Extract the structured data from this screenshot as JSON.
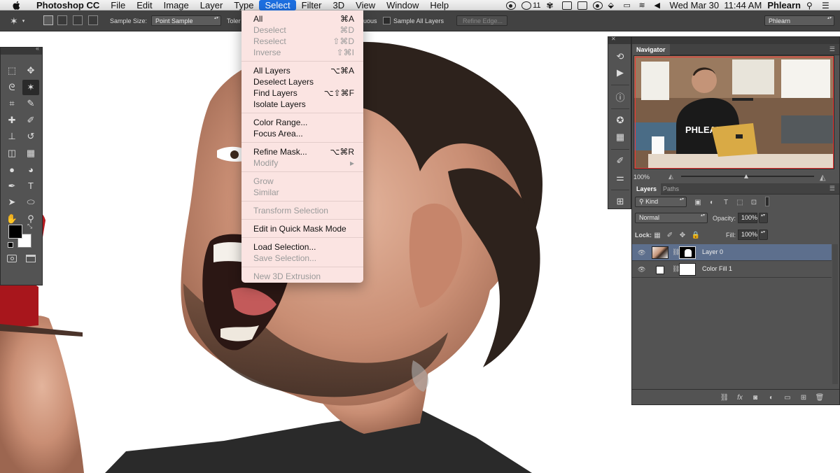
{
  "menubar": {
    "app_name": "Photoshop CC",
    "items": [
      "File",
      "Edit",
      "Image",
      "Layer",
      "Type",
      "Select",
      "Filter",
      "3D",
      "View",
      "Window",
      "Help"
    ],
    "active_index": 5,
    "tray_badge": "11",
    "datetime": "Wed Mar 30  11:44 AM",
    "user": "Phlearn"
  },
  "options_bar": {
    "sample_size_label": "Sample Size:",
    "sample_size_value": "Point Sample",
    "tolerance_label": "Toler",
    "contiguous_label": "uous",
    "sample_all_layers_label": "Sample All Layers",
    "refine_edge_label": "Refine Edge...",
    "workspace_value": "Phlearn"
  },
  "select_menu": {
    "groups": [
      [
        {
          "label": "All",
          "shortcut": "⌘A",
          "enabled": true
        },
        {
          "label": "Deselect",
          "shortcut": "⌘D",
          "enabled": false
        },
        {
          "label": "Reselect",
          "shortcut": "⇧⌘D",
          "enabled": false
        },
        {
          "label": "Inverse",
          "shortcut": "⇧⌘I",
          "enabled": false
        }
      ],
      [
        {
          "label": "All Layers",
          "shortcut": "⌥⌘A",
          "enabled": true
        },
        {
          "label": "Deselect Layers",
          "shortcut": "",
          "enabled": true
        },
        {
          "label": "Find Layers",
          "shortcut": "⌥⇧⌘F",
          "enabled": true
        },
        {
          "label": "Isolate Layers",
          "shortcut": "",
          "enabled": true
        }
      ],
      [
        {
          "label": "Color Range...",
          "shortcut": "",
          "enabled": true
        },
        {
          "label": "Focus Area...",
          "shortcut": "",
          "enabled": true
        }
      ],
      [
        {
          "label": "Refine Mask...",
          "shortcut": "⌥⌘R",
          "enabled": true
        },
        {
          "label": "Modify",
          "shortcut": "▸",
          "enabled": false
        }
      ],
      [
        {
          "label": "Grow",
          "shortcut": "",
          "enabled": false
        },
        {
          "label": "Similar",
          "shortcut": "",
          "enabled": false
        }
      ],
      [
        {
          "label": "Transform Selection",
          "shortcut": "",
          "enabled": false
        }
      ],
      [
        {
          "label": "Edit in Quick Mask Mode",
          "shortcut": "",
          "enabled": true
        }
      ],
      [
        {
          "label": "Load Selection...",
          "shortcut": "",
          "enabled": true
        },
        {
          "label": "Save Selection...",
          "shortcut": "",
          "enabled": false
        }
      ],
      [
        {
          "label": "New 3D Extrusion",
          "shortcut": "",
          "enabled": false
        }
      ]
    ]
  },
  "toolbox": {
    "tools": [
      {
        "icon": "marquee-tool-icon",
        "glyph": "⬚"
      },
      {
        "icon": "move-tool-icon",
        "glyph": "✥"
      },
      {
        "icon": "lasso-tool-icon",
        "glyph": "ᘓ"
      },
      {
        "icon": "magic-wand-tool-icon",
        "glyph": "✶"
      },
      {
        "icon": "crop-tool-icon",
        "glyph": "⌗"
      },
      {
        "icon": "eyedropper-tool-icon",
        "glyph": "✎"
      },
      {
        "icon": "healing-brush-tool-icon",
        "glyph": "✚"
      },
      {
        "icon": "brush-tool-icon",
        "glyph": "✐"
      },
      {
        "icon": "clone-stamp-tool-icon",
        "glyph": "⊥"
      },
      {
        "icon": "history-brush-tool-icon",
        "glyph": "↺"
      },
      {
        "icon": "eraser-tool-icon",
        "glyph": "◫"
      },
      {
        "icon": "gradient-tool-icon",
        "glyph": "▦"
      },
      {
        "icon": "blur-tool-icon",
        "glyph": "●"
      },
      {
        "icon": "dodge-tool-icon",
        "glyph": "◕"
      },
      {
        "icon": "pen-tool-icon",
        "glyph": "✒"
      },
      {
        "icon": "type-tool-icon",
        "glyph": "T"
      },
      {
        "icon": "path-selection-tool-icon",
        "glyph": "➤"
      },
      {
        "icon": "ellipse-tool-icon",
        "glyph": "⬭"
      },
      {
        "icon": "hand-tool-icon",
        "glyph": "✋"
      },
      {
        "icon": "zoom-tool-icon",
        "glyph": "⚲"
      }
    ],
    "selected_tool_index": 3,
    "foreground_color": "#000000",
    "background_color": "#ffffff"
  },
  "navigator": {
    "tab_label": "Navigator",
    "zoom_value": "100%"
  },
  "layers_panel": {
    "tabs": [
      "Layers",
      "Paths"
    ],
    "filter_value": "Kind",
    "blend_mode_value": "Normal",
    "opacity_label": "Opacity:",
    "opacity_value": "100%",
    "lock_label": "Lock:",
    "fill_label": "Fill:",
    "fill_value": "100%",
    "layers": [
      {
        "name": "Layer 0",
        "selected": true
      },
      {
        "name": "Color Fill 1",
        "selected": false
      }
    ]
  },
  "nav_thumbnail_text": "PHLEARN"
}
